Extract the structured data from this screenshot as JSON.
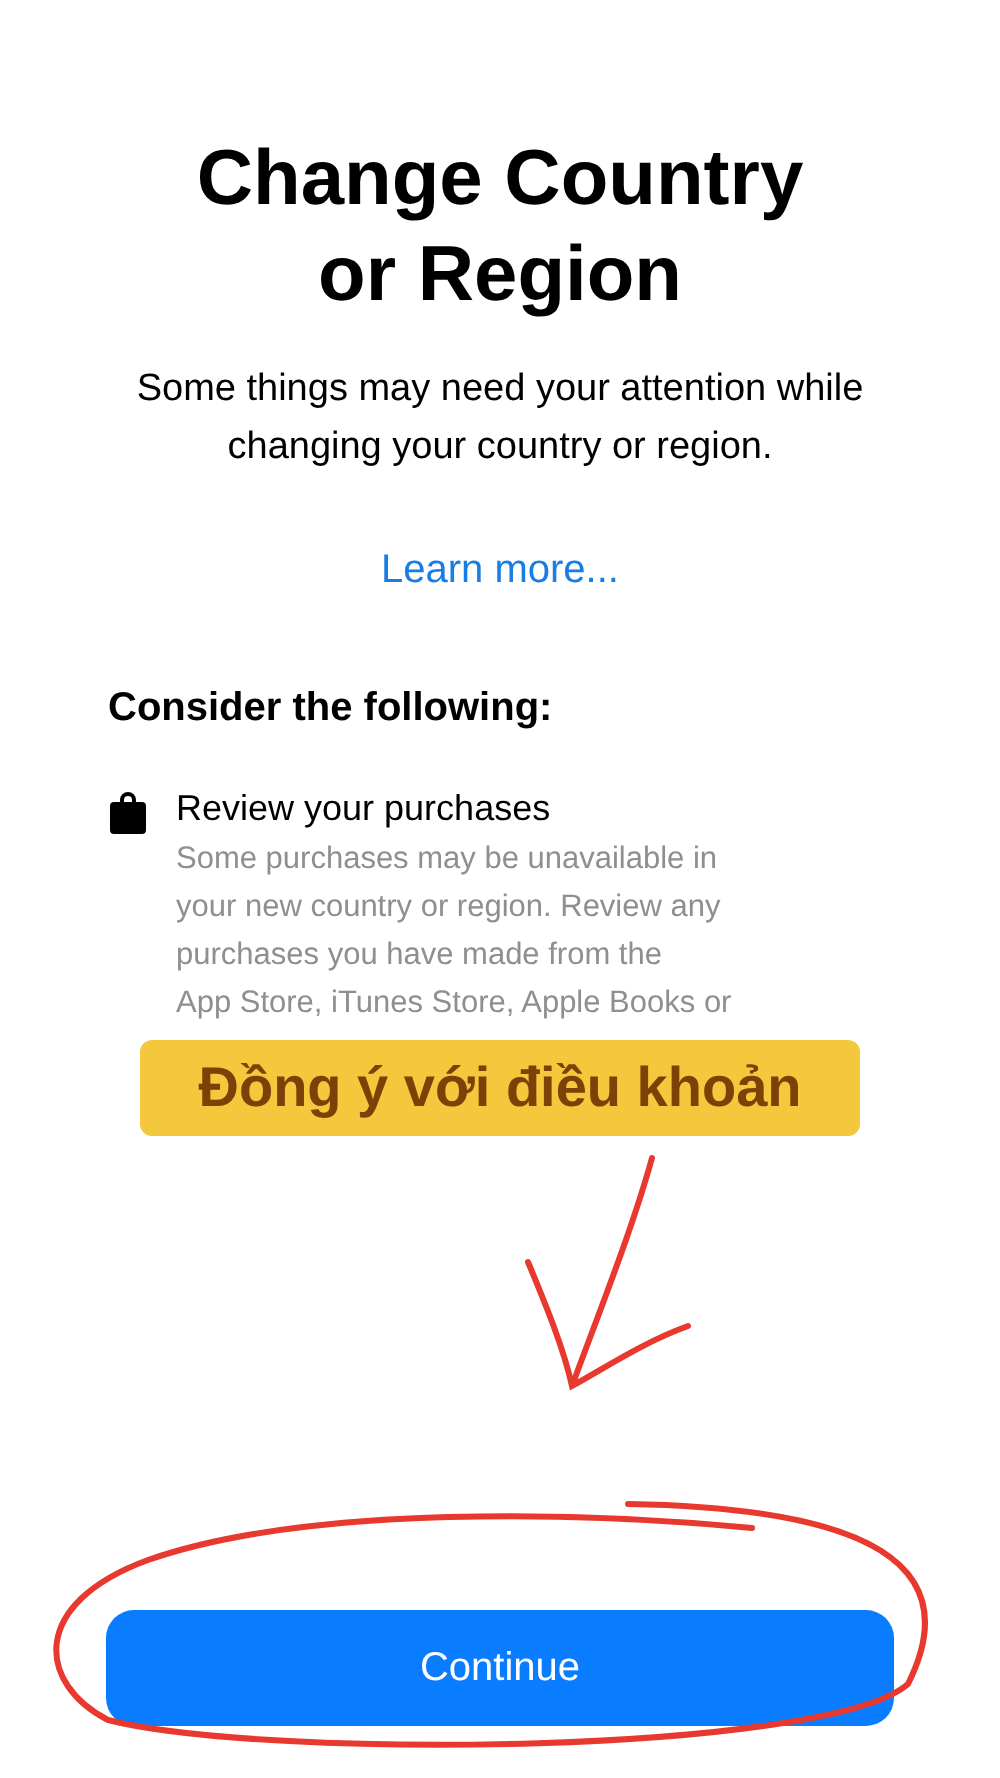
{
  "title": "Change Country or Region",
  "subtitle": "Some things may need your attention while changing your country or region.",
  "link": "Learn more...",
  "section_heading": "Consider the following:",
  "items": [
    {
      "title": "Review your purchases",
      "description_lines": [
        "Some purchases may be unavailable in",
        "your new country or region. Review any",
        "purchases you have made from the",
        "App Store, iTunes Store, Apple Books or"
      ]
    }
  ],
  "annotation": {
    "label": "Đồng ý với điều khoản"
  },
  "button": "Continue"
}
